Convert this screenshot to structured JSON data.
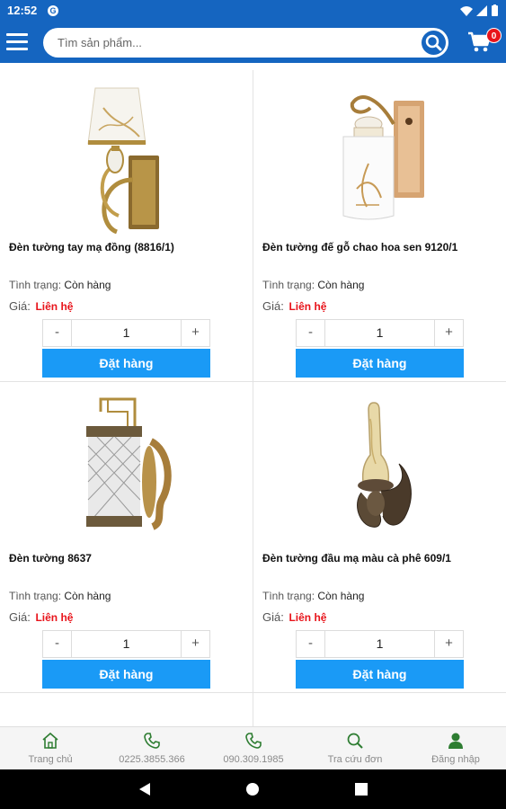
{
  "status_bar": {
    "time": "12:52"
  },
  "header": {
    "search_placeholder": "Tìm sản phẩm...",
    "cart_count": "0"
  },
  "labels": {
    "status": "Tình trạng:",
    "price": "Giá:",
    "order_button": "Đặt hàng"
  },
  "products": [
    {
      "name": "Đèn tường tay mạ đồng (8816/1)",
      "status": "Còn hàng",
      "price": "Liên hệ",
      "quantity": "1"
    },
    {
      "name": "Đèn tường đế gỗ chao hoa sen 9120/1",
      "status": "Còn hàng",
      "price": "Liên hệ",
      "quantity": "1"
    },
    {
      "name": "Đèn tường 8637",
      "status": "Còn hàng",
      "price": "Liên hệ",
      "quantity": "1"
    },
    {
      "name": "Đèn tường đầu mạ màu cà phê 609/1",
      "status": "Còn hàng",
      "price": "Liên hệ",
      "quantity": "1"
    }
  ],
  "stepper": {
    "minus": "-",
    "plus": "+"
  },
  "bottom_nav": [
    {
      "label": "Trang chủ",
      "icon": "home-icon"
    },
    {
      "label": "0225.3855.366",
      "icon": "phone-icon"
    },
    {
      "label": "090.309.1985",
      "icon": "phone-icon"
    },
    {
      "label": "Tra cứu đơn",
      "icon": "search-icon"
    },
    {
      "label": "Đăng nhập",
      "icon": "user-icon"
    }
  ],
  "colors": {
    "primary": "#1565c0",
    "button": "#1a9af6",
    "price": "#e8141b",
    "nav_icon": "#2e7d32"
  }
}
